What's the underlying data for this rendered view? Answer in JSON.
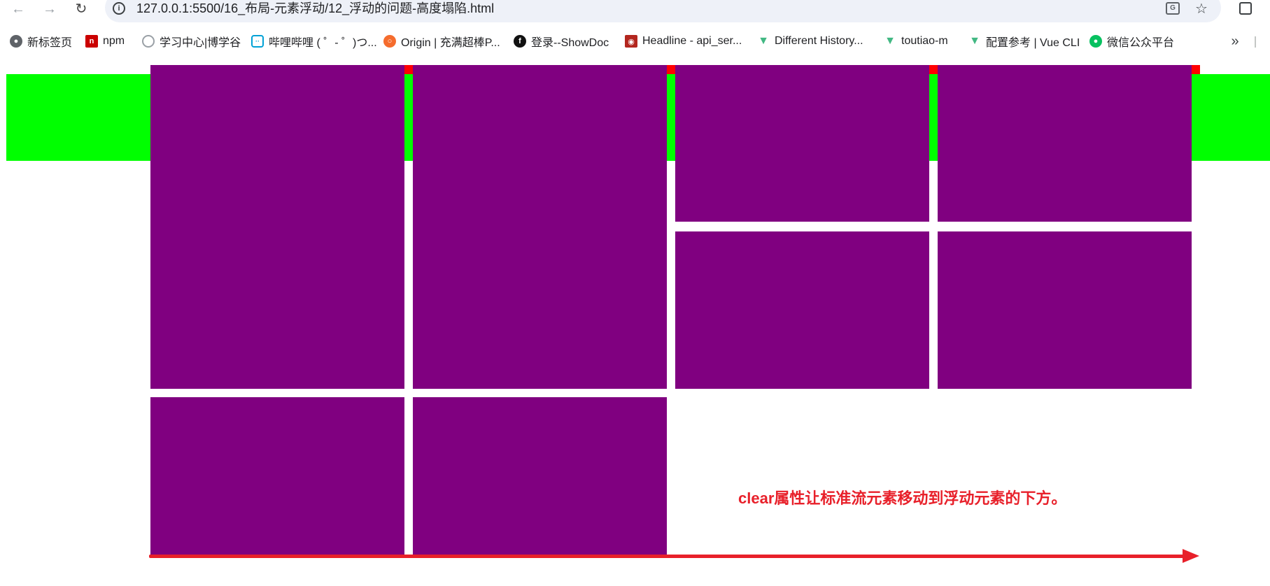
{
  "browser": {
    "url": "127.0.0.1:5500/16_布局-元素浮动/12_浮动的问题-高度塌陷.html",
    "back_icon": "back-arrow-icon",
    "forward_icon": "forward-arrow-icon",
    "reload_icon": "reload-icon",
    "site_info_icon": "info-icon",
    "translate_icon": "translate-icon",
    "star_icon": "bookmark-star-icon",
    "extensions_icon": "extensions-icon"
  },
  "bookmarks": [
    {
      "label": "新标签页",
      "icon": "globe-icon",
      "color": "#5f6368"
    },
    {
      "label": "npm",
      "icon": "npm-icon",
      "color": "#cb0000"
    },
    {
      "label": "学习中心|博学谷",
      "icon": "circle-logo-icon",
      "color": "#9aa0a6"
    },
    {
      "label": "哔哩哔哩 ( ゜- ゜)つ...",
      "icon": "bilibili-icon",
      "color": "#00a1d6"
    },
    {
      "label": "Origin | 充满超棒P...",
      "icon": "origin-icon",
      "color": "#f56c2d"
    },
    {
      "label": "登录--ShowDoc",
      "icon": "showdoc-icon",
      "color": "#111111"
    },
    {
      "label": "Headline - api_ser...",
      "icon": "headline-icon",
      "color": "#b3261e"
    },
    {
      "label": "Different History...",
      "icon": "vue-icon",
      "color": "#42b883"
    },
    {
      "label": "toutiao-m",
      "icon": "vue-icon",
      "color": "#42b883"
    },
    {
      "label": "配置参考 | Vue CLI",
      "icon": "vue-icon",
      "color": "#42b883"
    },
    {
      "label": "微信公众平台",
      "icon": "wechat-icon",
      "color": "#07c160"
    }
  ],
  "page": {
    "colors": {
      "container_bg": "#00ff00",
      "float_item": "#800080",
      "float_strip": "#ff0000",
      "annotation": "#e8202a"
    },
    "annotation_text": "clear属性让标准流元素移动到浮动元素的下方。"
  }
}
